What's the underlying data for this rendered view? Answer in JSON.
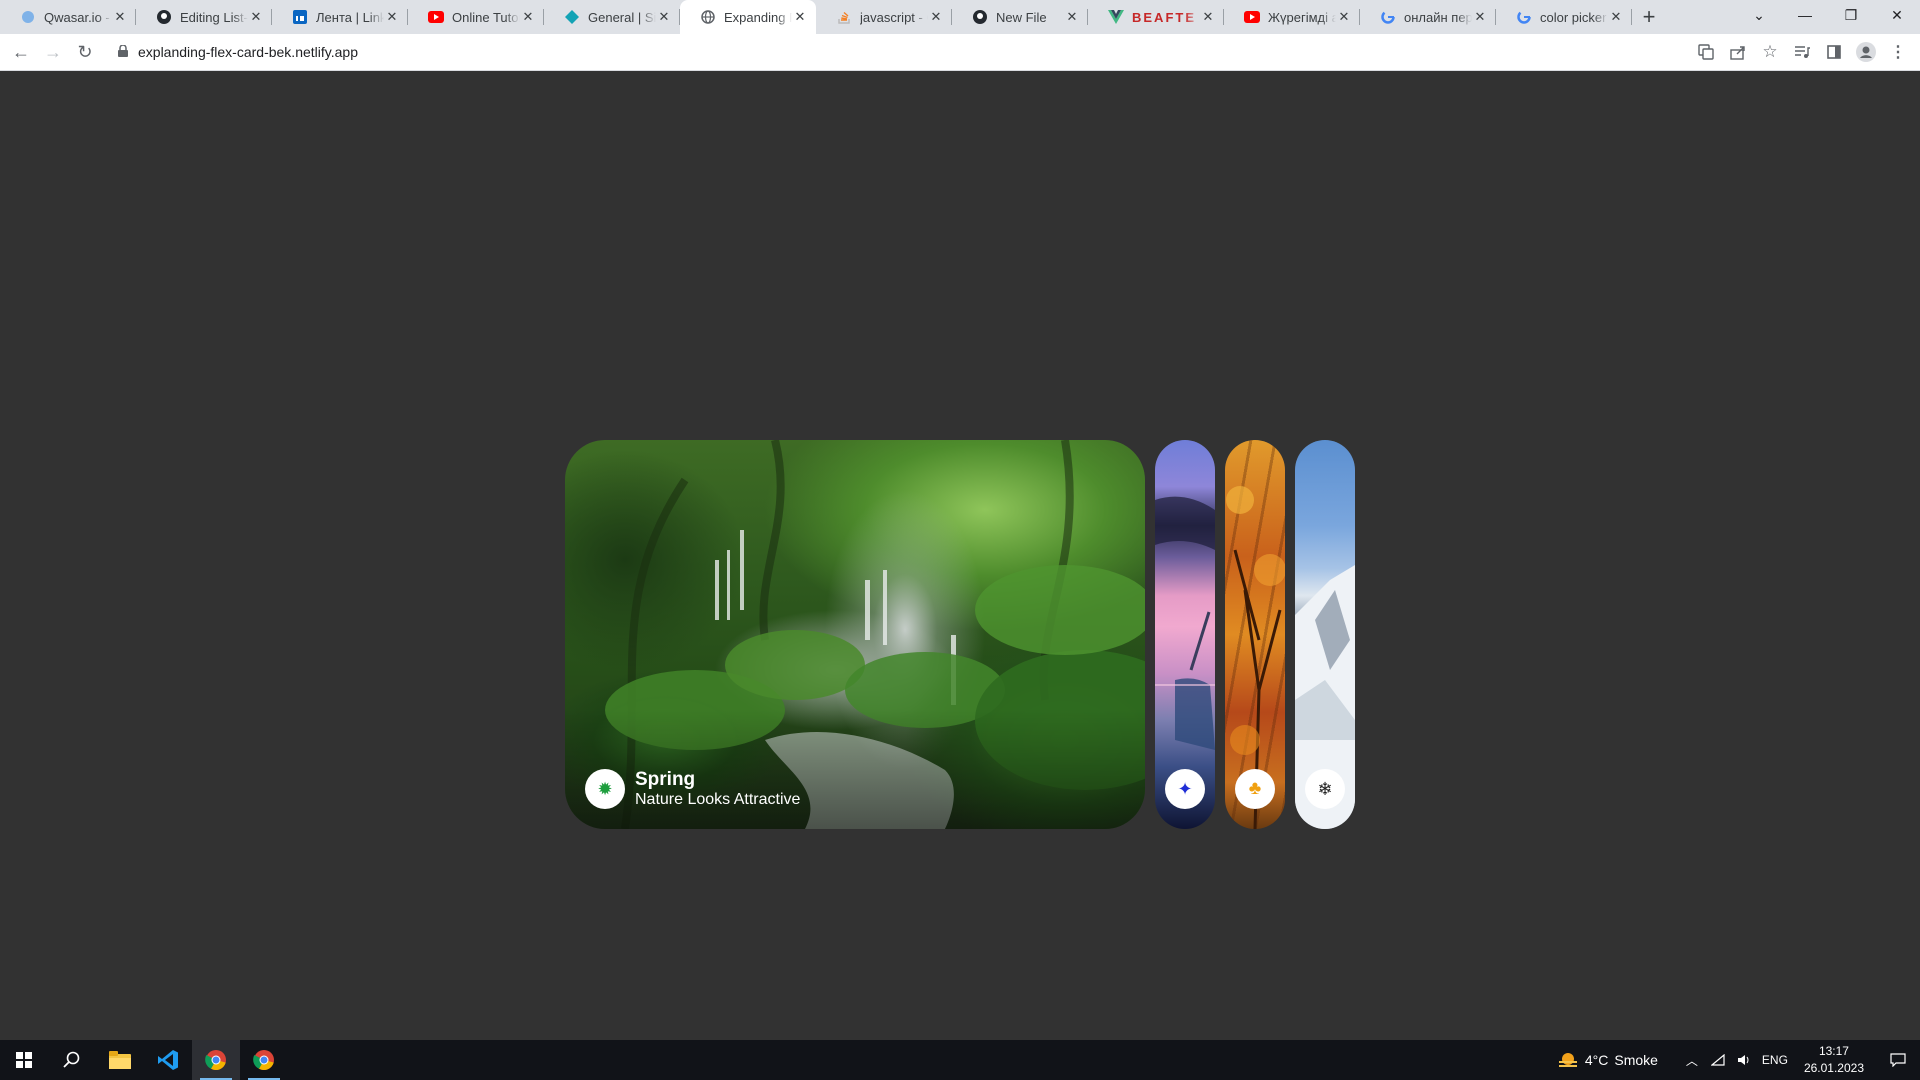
{
  "browser": {
    "tabs": [
      {
        "title": "Qwasar.io - K",
        "icon": "qwasar-icon"
      },
      {
        "title": "Editing List-St",
        "icon": "github-icon"
      },
      {
        "title": "Лента | Linked",
        "icon": "linkedin-icon"
      },
      {
        "title": "Online Tutoria",
        "icon": "youtube-icon"
      },
      {
        "title": "General | Site",
        "icon": "diamond-icon"
      },
      {
        "title": "Expanding Fle",
        "icon": "globe-icon",
        "active": true
      },
      {
        "title": "javascript - Ge",
        "icon": "stackoverflow-icon"
      },
      {
        "title": "New File",
        "icon": "github-icon"
      },
      {
        "title": "BEAFTE",
        "icon": "vue-icon"
      },
      {
        "title": "Жүрегімді ая",
        "icon": "youtube-icon"
      },
      {
        "title": "онлайн пере",
        "icon": "google-icon"
      },
      {
        "title": "color picker -",
        "icon": "google-icon"
      }
    ],
    "new_tab_label": "+",
    "url": "explanding-flex-card-bek.netlify.app"
  },
  "cards": [
    {
      "title": "Spring",
      "subtitle": "Nature Looks Attractive",
      "icon": "sun-icon",
      "icon_glyph": "✹",
      "icon_color": "#1e9e3e",
      "expanded": true
    },
    {
      "title": "",
      "subtitle": "",
      "icon": "sparkle-icon",
      "icon_glyph": "✦",
      "icon_color": "#1f2ed6",
      "expanded": false
    },
    {
      "title": "",
      "subtitle": "",
      "icon": "tree-icon",
      "icon_glyph": "♣",
      "icon_color": "#f0a010",
      "expanded": false
    },
    {
      "title": "",
      "subtitle": "",
      "icon": "snowflake-icon",
      "icon_glyph": "❄",
      "icon_color": "#222222",
      "expanded": false
    }
  ],
  "taskbar": {
    "weather_temp": "4°C",
    "weather_text": "Smoke",
    "language": "ENG",
    "time": "13:17",
    "date": "26.01.2023"
  },
  "colors": {
    "page_background": "#323232",
    "tab_strip": "#dee1e6",
    "taskbar": "#111318"
  }
}
